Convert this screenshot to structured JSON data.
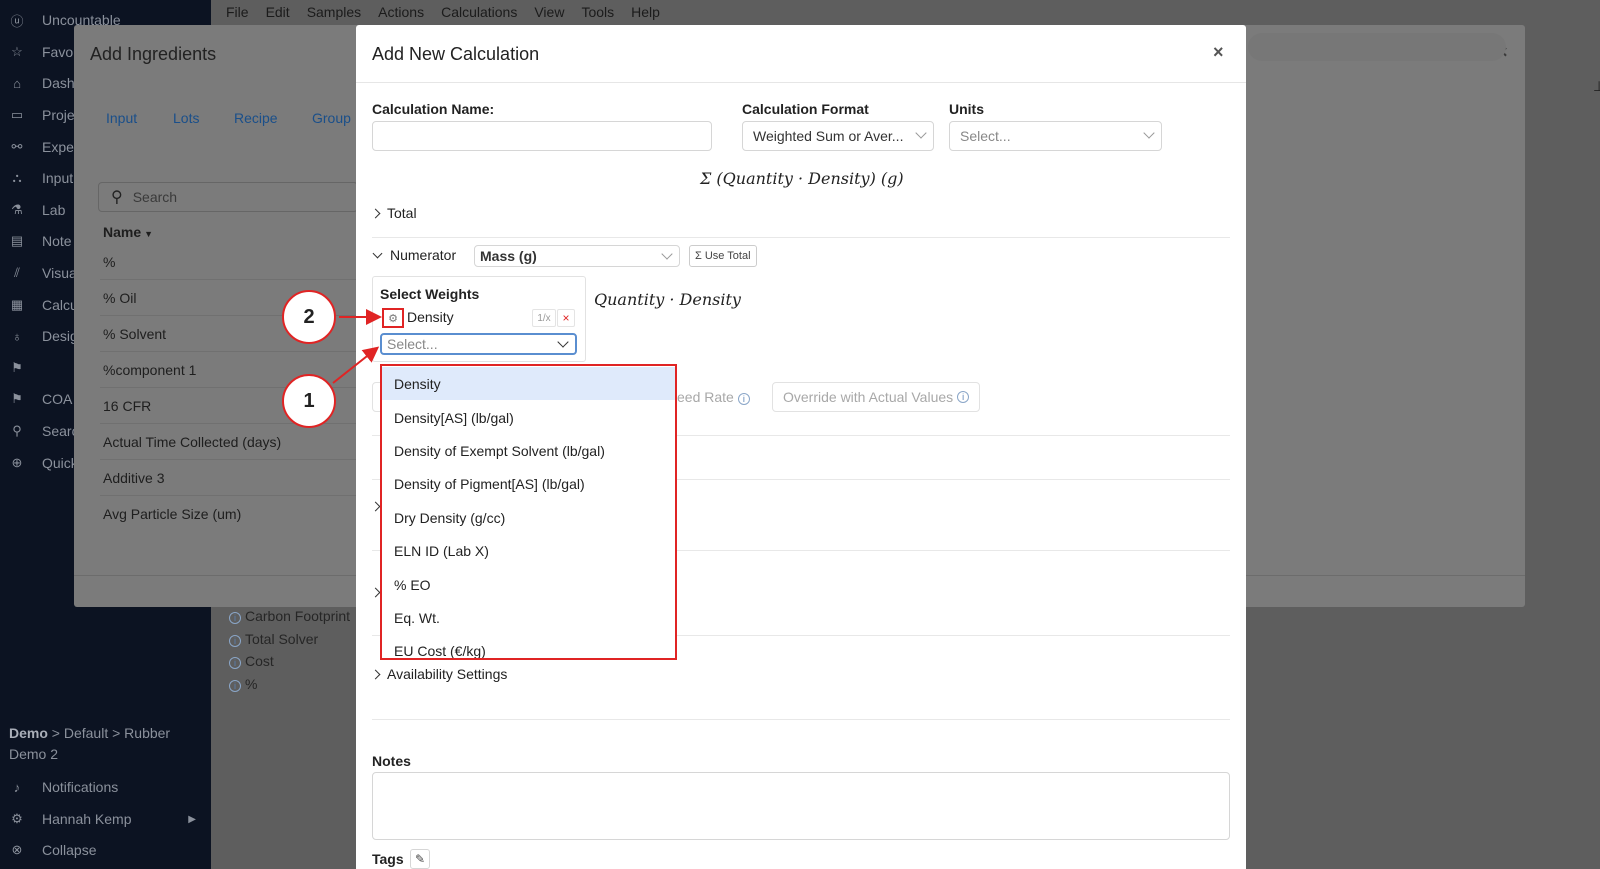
{
  "sidebar": {
    "items": [
      {
        "icon": "uncountable-logo-icon",
        "label": "Uncountable"
      },
      {
        "icon": "star-icon",
        "label": "Favo"
      },
      {
        "icon": "home-icon",
        "label": "Dash"
      },
      {
        "icon": "folder-icon",
        "label": "Proje"
      },
      {
        "icon": "flow-icon",
        "label": "Expe"
      },
      {
        "icon": "cubes-icon",
        "label": "Input"
      },
      {
        "icon": "flask-icon",
        "label": "Lab"
      },
      {
        "icon": "notebook-icon",
        "label": "Note"
      },
      {
        "icon": "chart-icon",
        "label": "Visua"
      },
      {
        "icon": "list-icon",
        "label": "Calcu"
      },
      {
        "icon": "bulb-icon",
        "label": "Desig"
      },
      {
        "icon": "bookmark-icon",
        "label": ""
      },
      {
        "icon": "bookmark-icon",
        "label": "COA"
      },
      {
        "icon": "search-icon",
        "label": "Searc"
      },
      {
        "icon": "plus-circle-icon",
        "label": "Quick"
      }
    ],
    "breadcrumb_bold": "Demo",
    "breadcrumb_rest": " > Default > Rubber",
    "breadcrumb_line2": "Demo 2",
    "notifications": "Notifications",
    "user": "Hannah Kemp",
    "collapse": "Collapse"
  },
  "menubar": [
    "File",
    "Edit",
    "Samples",
    "Actions",
    "Calculations",
    "View",
    "Tools",
    "Help"
  ],
  "background": {
    "list": [
      "Carbon Footprint",
      "Total Solver",
      "Cost",
      "%"
    ]
  },
  "ingredients_modal": {
    "title": "Add Ingredients",
    "tabs": [
      "Input",
      "Lots",
      "Recipe",
      "Group"
    ],
    "search_placeholder": "Search",
    "column_header": "Name",
    "rows": [
      "%",
      "% Oil",
      "% Solvent",
      "%component 1",
      "16 CFR",
      "Actual Time Collected (days)",
      "Additive 3",
      "Avg Particle Size (um)"
    ]
  },
  "calc_modal": {
    "title": "Add New Calculation",
    "close": "×",
    "name_label": "Calculation Name:",
    "name_value": "",
    "format_label": "Calculation Format",
    "format_value": "Weighted Sum or Aver...",
    "units_label": "Units",
    "units_placeholder": "Select...",
    "formula_total": "Σ (Quantity · Density) (g)",
    "total_section": "Total",
    "numerator_section": "Numerator",
    "numerator_value": "Mass (g)",
    "use_total": "Σ Use Total",
    "select_weights": "Select Weights",
    "weight_item": "Density",
    "weight_inverse": "1/x",
    "weight_remove": "×",
    "weight_select_placeholder": "Select...",
    "formula_numerator": "Quantity · Density",
    "feed_rate_fragment": "eed Rate",
    "override_button": "Override with Actual Values",
    "availability": "Availability Settings",
    "notes_label": "Notes",
    "tags_label": "Tags"
  },
  "dropdown_options": [
    "Density",
    "Density[AS] (lb/gal)",
    "Density of Exempt Solvent (lb/gal)",
    "Density of Pigment[AS] (lb/gal)",
    "Dry Density (g/cc)",
    "ELN ID (Lab X)",
    "% EO",
    "Eq. Wt.",
    "EU Cost (€/kg)"
  ],
  "callouts": {
    "one": "1",
    "two": "2"
  },
  "colors": {
    "sidebar": "#0c1322",
    "highlight": "#e02424",
    "selected_option": "#dfeafb"
  }
}
